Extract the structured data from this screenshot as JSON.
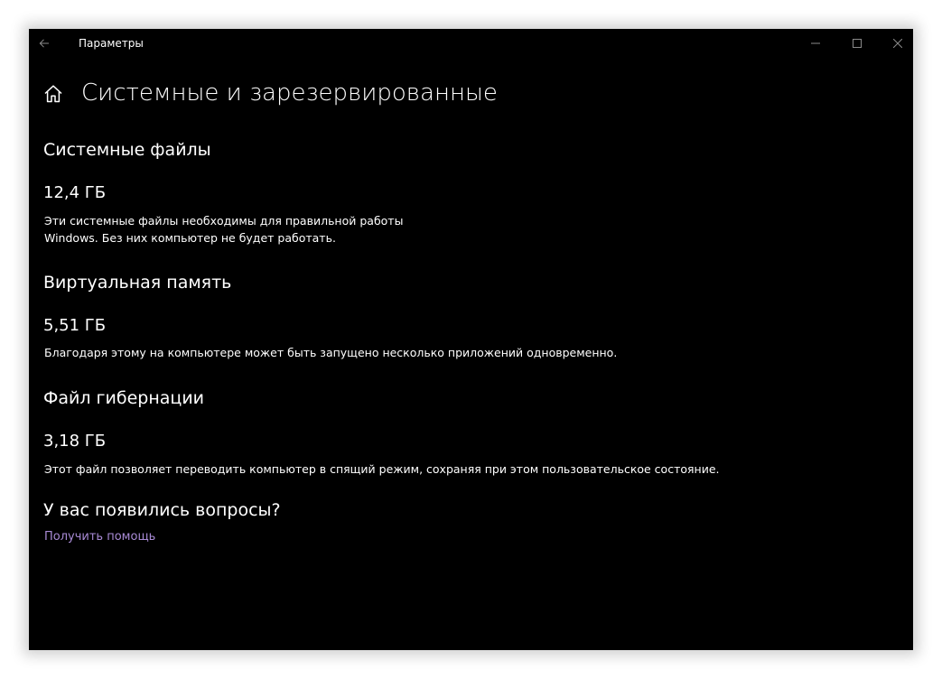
{
  "window": {
    "app_title": "Параметры"
  },
  "page": {
    "title": "Системные и зарезервированные"
  },
  "sections": [
    {
      "heading": "Системные файлы",
      "size": "12,4 ГБ",
      "description_lines": [
        "Эти системные файлы необходимы для правильной работы",
        "Windows. Без них компьютер не будет работать."
      ]
    },
    {
      "heading": "Виртуальная память",
      "size": "5,51 ГБ",
      "description_lines": [
        "Благодаря этому на компьютере может быть запущено несколько приложений одновременно."
      ]
    },
    {
      "heading": "Файл гибернации",
      "size": "3,18 ГБ",
      "description_lines": [
        "Этот файл позволяет переводить компьютер в спящий режим, сохраняя при этом пользовательское состояние."
      ]
    }
  ],
  "help": {
    "heading": "У вас появились вопросы?",
    "link_label": "Получить помощь"
  },
  "colors": {
    "link": "#a98bd6"
  },
  "icons": {
    "back": "back-arrow-icon",
    "home": "home-icon",
    "minimize": "minimize-icon",
    "maximize": "maximize-icon",
    "close": "close-icon"
  }
}
